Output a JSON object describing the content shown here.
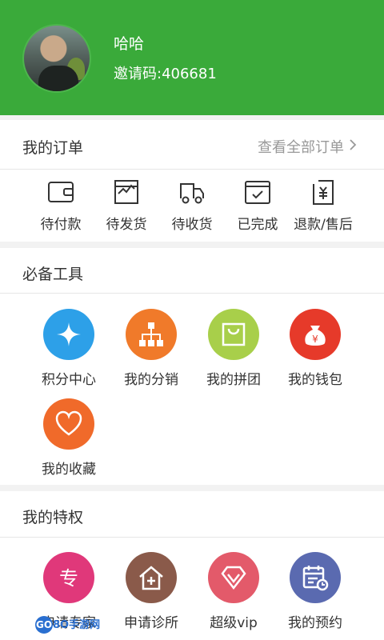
{
  "profile": {
    "name": "哈哈",
    "invite": "邀请码:406681"
  },
  "orders": {
    "title": "我的订单",
    "view_all": "查看全部订单",
    "items": [
      {
        "label": "待付款",
        "icon": "wallet-icon"
      },
      {
        "label": "待发货",
        "icon": "box-icon"
      },
      {
        "label": "待收货",
        "icon": "truck-icon"
      },
      {
        "label": "已完成",
        "icon": "check-box-icon"
      },
      {
        "label": "退款/售后",
        "icon": "refund-icon"
      }
    ]
  },
  "tools": {
    "title": "必备工具",
    "items": [
      {
        "label": "积分中心",
        "icon": "star-icon",
        "color": "#2da0e8"
      },
      {
        "label": "我的分销",
        "icon": "hierarchy-icon",
        "color": "#f07a2a"
      },
      {
        "label": "我的拼团",
        "icon": "bag-icon",
        "color": "#a8cf4a"
      },
      {
        "label": "我的钱包",
        "icon": "money-bag-icon",
        "color": "#e63a2a"
      },
      {
        "label": "我的收藏",
        "icon": "heart-icon",
        "color": "#f06a2a"
      }
    ]
  },
  "privileges": {
    "title": "我的特权",
    "items": [
      {
        "label": "申请专家",
        "icon": "expert-icon",
        "color": "#e0387a",
        "glyph": "专"
      },
      {
        "label": "申请诊所",
        "icon": "clinic-icon",
        "color": "#8a5a4a"
      },
      {
        "label": "超级vip",
        "icon": "diamond-icon",
        "color": "#e35a6a"
      },
      {
        "label": "我的预约",
        "icon": "calendar-icon",
        "color": "#5a6ab0"
      }
    ]
  },
  "watermark": {
    "ball": "GO",
    "text": "8O手游网"
  }
}
